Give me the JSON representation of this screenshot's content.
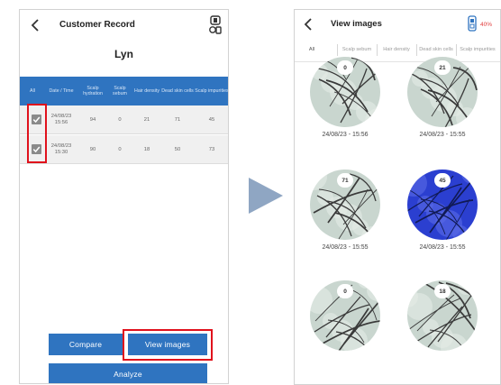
{
  "left_screen": {
    "title": "Customer Record",
    "customer_name": "Lyn",
    "columns": [
      "All",
      "Date / Time",
      "Scalp hydration",
      "Scalp sebum",
      "Hair density",
      "Dead skin cells",
      "Scalp impurities"
    ],
    "rows": [
      {
        "date": "24/08/23",
        "time": "15:56",
        "values": [
          "94",
          "0",
          "21",
          "71",
          "45"
        ],
        "checked": true
      },
      {
        "date": "24/08/23",
        "time": "15:30",
        "values": [
          "90",
          "0",
          "18",
          "50",
          "73"
        ],
        "checked": true
      }
    ],
    "buttons": {
      "compare": "Compare",
      "view_images": "View images",
      "analyze": "Analyze"
    }
  },
  "right_screen": {
    "title": "View images",
    "battery_percent": "40%",
    "tabs": [
      "All",
      "Scalp sebum",
      "Hair density",
      "Dead skin cells",
      "Scalp impurities"
    ],
    "images": [
      {
        "badge": "0",
        "timestamp": "24/08/23 - 15:56",
        "tone": "natural"
      },
      {
        "badge": "21",
        "timestamp": "24/08/23 - 15:55",
        "tone": "natural"
      },
      {
        "badge": "71",
        "timestamp": "24/08/23 - 15:55",
        "tone": "natural"
      },
      {
        "badge": "45",
        "timestamp": "24/08/23 - 15:55",
        "tone": "blue"
      },
      {
        "badge": "0",
        "timestamp": "",
        "tone": "natural"
      },
      {
        "badge": "18",
        "timestamp": "",
        "tone": "natural"
      }
    ]
  },
  "colors": {
    "primary": "#2f74c0",
    "highlight": "#e0111c",
    "arrow": "#8fa6c3",
    "battery": "#e03b3b"
  }
}
